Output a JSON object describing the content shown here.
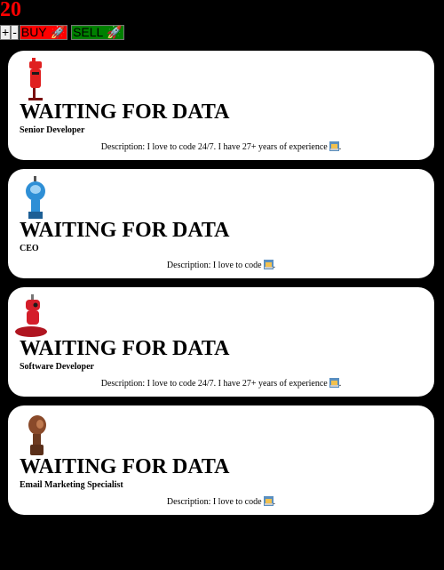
{
  "counter": "20",
  "controls": {
    "plus_label": "+",
    "minus_label": "-",
    "buy_label": "BUY",
    "sell_label": "SELL",
    "rocket_glyph": "🚀"
  },
  "cards": [
    {
      "title": "WAITING FOR DATA",
      "role": "Senior Developer",
      "description": "Description: I love to code 24/7. I have 27+ years of experience",
      "avatar_color": "#e02020"
    },
    {
      "title": "WAITING FOR DATA",
      "role": "CEO",
      "description": "Description: I love to code",
      "avatar_color": "#2e8fd6"
    },
    {
      "title": "WAITING FOR DATA",
      "role": "Software Developer",
      "description": "Description: I love to code 24/7. I have 27+ years of experience",
      "avatar_color": "#d41e2a"
    },
    {
      "title": "WAITING FOR DATA",
      "role": "Email Marketing Specialist",
      "description": "Description: I love to code",
      "avatar_color": "#8a4a2a"
    }
  ]
}
